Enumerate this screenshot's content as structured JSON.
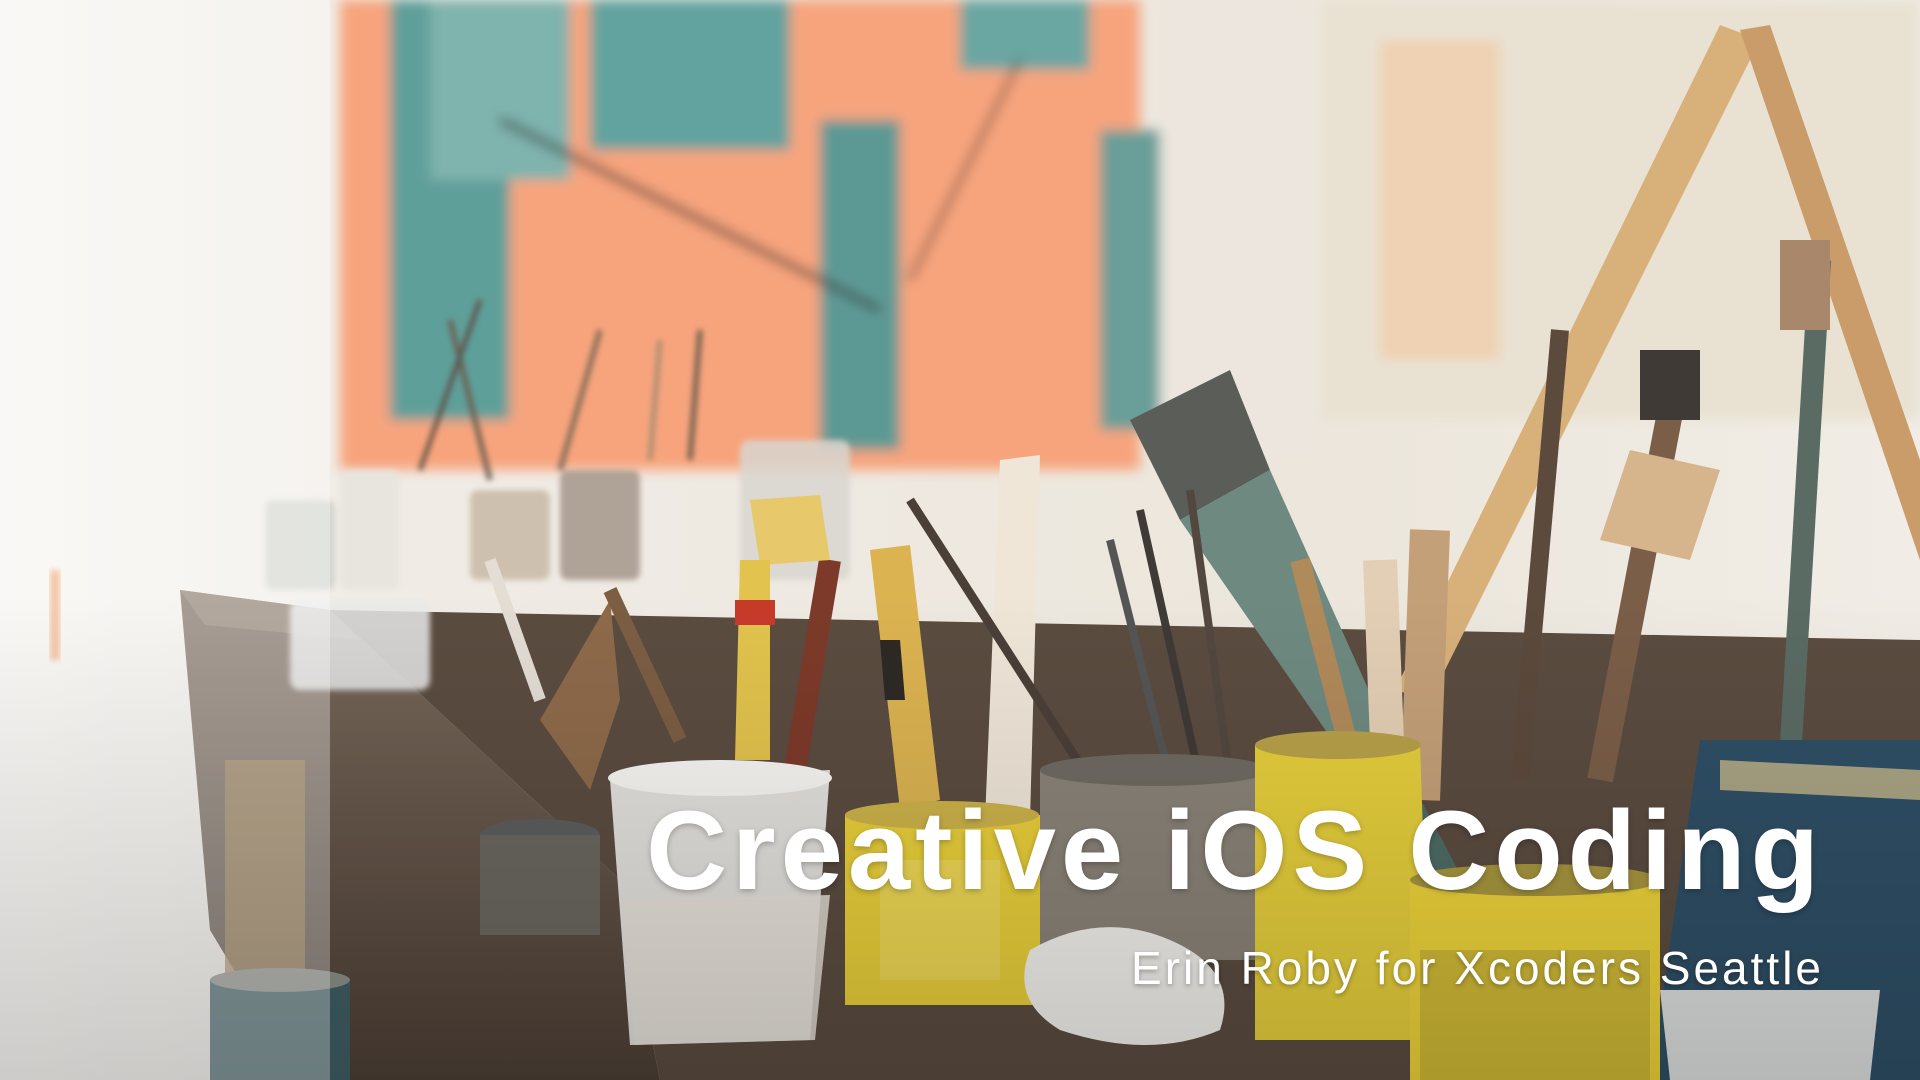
{
  "slide": {
    "title": "Creative iOS Coding",
    "subtitle": "Erin Roby for Xcoders Seattle",
    "text_color": "#ffffff"
  },
  "background": {
    "palette": {
      "wall": "#f3efe9",
      "canvas_orange": "#f6a27c",
      "canvas_teal": "#6aa6a2",
      "table_wood": "#6b5a4c",
      "can_yellow": "#e9cf3a",
      "can_blue": "#2f4f66",
      "brush_handle": "#d8b07a"
    }
  }
}
